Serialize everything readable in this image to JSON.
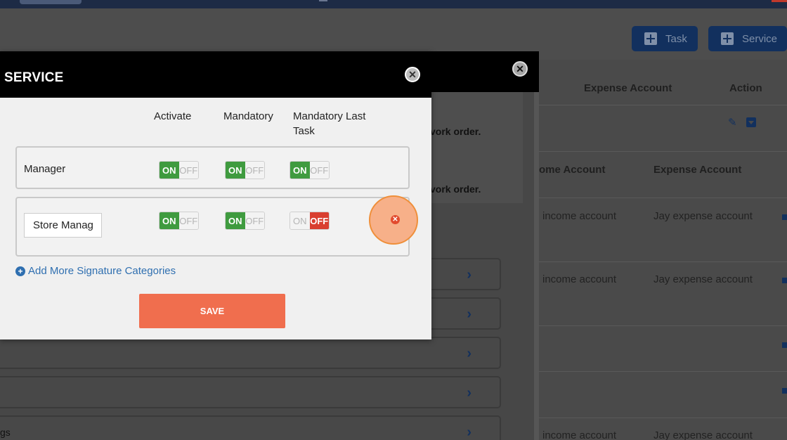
{
  "header": {
    "task_label": "Task",
    "service_label": "Service"
  },
  "background_table": {
    "top_headers": {
      "expense_account": "Expense Account",
      "action": "Action"
    },
    "middle_headers": {
      "income_account": "ome Account",
      "expense_account": "Expense Account"
    },
    "rows": [
      {
        "income": "income account",
        "expense": "Jay expense account"
      },
      {
        "income": "income account",
        "expense": "Jay expense account"
      },
      {
        "income": "income account",
        "expense": "Jay expense account"
      }
    ]
  },
  "middle_panel": {
    "notice_1": "vork order.",
    "notice_2": "vork order.",
    "bottom_label": "gs"
  },
  "modal": {
    "title": "SERVICE",
    "close_icon": "close-icon",
    "columns": {
      "activate": "Activate",
      "mandatory": "Mandatory",
      "mandatory_last_task": "Mandatory Last Task"
    },
    "signature_categories": [
      {
        "name": "Manager",
        "activate": {
          "on": "ON",
          "off": "OFF",
          "value": "ON"
        },
        "mandatory": {
          "on": "ON",
          "off": "OFF",
          "value": "ON"
        },
        "mandatory_last_task": {
          "on": "ON",
          "off": "OFF",
          "value": "ON"
        }
      },
      {
        "name": "Store Manag",
        "activate": {
          "on": "ON",
          "off": "OFF",
          "value": "ON"
        },
        "mandatory": {
          "on": "ON",
          "off": "OFF",
          "value": "ON"
        },
        "mandatory_last_task": {
          "on": "ON",
          "off": "OFF",
          "value": "OFF"
        }
      }
    ],
    "add_more_label": "Add More Signature Categories",
    "save_label": "SAVE"
  },
  "colors": {
    "toggle_on": "#3f9b3f",
    "toggle_off": "#d93f30",
    "save_button": "#f06e4e",
    "link": "#2f6fb0",
    "highlight": "#f7b089"
  }
}
